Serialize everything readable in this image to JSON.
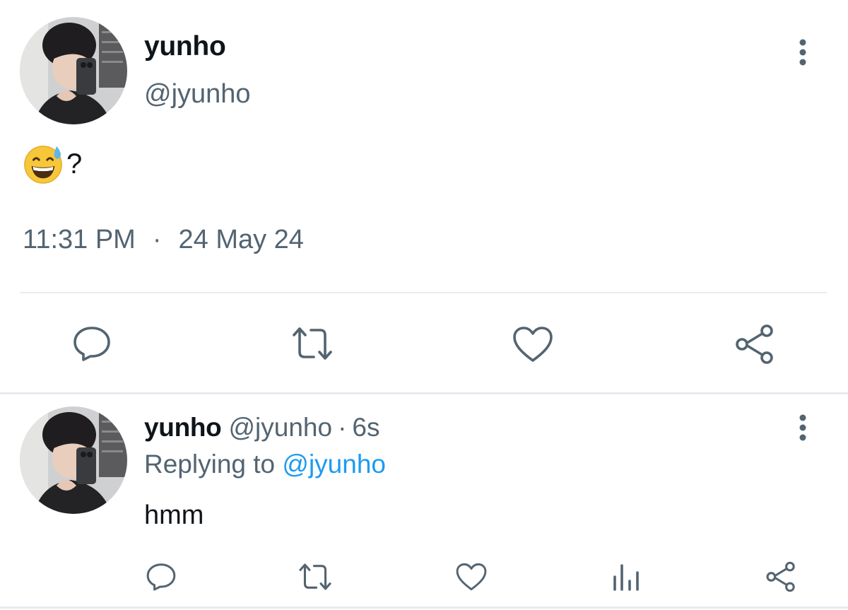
{
  "colors": {
    "text": "#0f1419",
    "secondary": "#536471",
    "link": "#1d9bf0",
    "divider": "#e6ecf0"
  },
  "main_tweet": {
    "author_name": "yunho",
    "handle": "@jyunho",
    "text_emoji_icon": "grinning-face-with-sweat-icon",
    "text": "?",
    "time": "11:31 PM",
    "separator": "·",
    "date": "24 May 24",
    "actions": [
      "reply-icon",
      "retweet-icon",
      "like-icon",
      "share-icon"
    ]
  },
  "reply_tweet": {
    "author_name": "yunho",
    "handle": "@jyunho",
    "separator": "·",
    "time_ago": "6s",
    "replying_prefix": "Replying to",
    "replying_handle": "@jyunho",
    "text": "hmm",
    "actions": [
      "reply-icon",
      "retweet-icon",
      "like-icon",
      "analytics-icon",
      "share-icon"
    ]
  }
}
